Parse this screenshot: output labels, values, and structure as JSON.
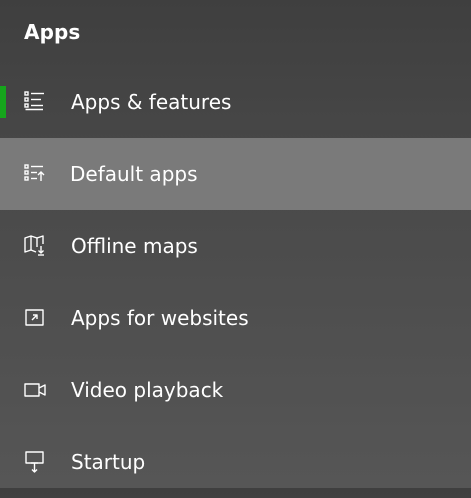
{
  "nav": {
    "header": "Apps",
    "items": [
      {
        "label": "Apps & features",
        "icon": "apps-features-list-icon",
        "selected": true
      },
      {
        "label": "Default apps",
        "icon": "default-apps-list-icon",
        "hovered": true
      },
      {
        "label": "Offline maps",
        "icon": "offline-maps-icon"
      },
      {
        "label": "Apps for websites",
        "icon": "apps-for-websites-icon"
      },
      {
        "label": "Video playback",
        "icon": "video-playback-icon"
      },
      {
        "label": "Startup",
        "icon": "startup-icon"
      }
    ]
  },
  "colors": {
    "accent": "#16a51c",
    "hover_background": "#7a7a7a",
    "background": "#4a4a4a",
    "text": "#ffffff"
  }
}
